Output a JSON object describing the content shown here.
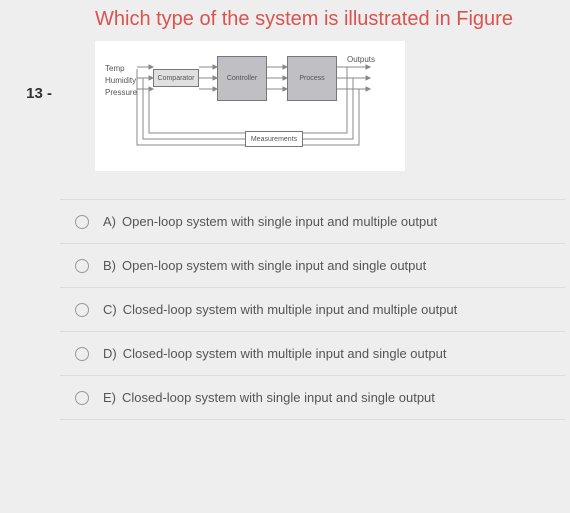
{
  "question_number": "13 -",
  "question_title": "Which type of the system is illustrated in Figure",
  "diagram": {
    "inputs": [
      "Temp",
      "Humidity",
      "Pressure"
    ],
    "outputs_label": "Outputs",
    "comparator": "Comparator",
    "controller": "Controller",
    "process": "Process",
    "measurements": "Measurements"
  },
  "options": [
    {
      "letter": "A)",
      "text": "Open-loop system with single input and multiple output"
    },
    {
      "letter": "B)",
      "text": "Open-loop system with single input and single output"
    },
    {
      "letter": "C)",
      "text": "Closed-loop system with multiple input and multiple output"
    },
    {
      "letter": "D)",
      "text": "Closed-loop system with multiple input and single output"
    },
    {
      "letter": "E)",
      "text": "Closed-loop system with single input and single output"
    }
  ]
}
